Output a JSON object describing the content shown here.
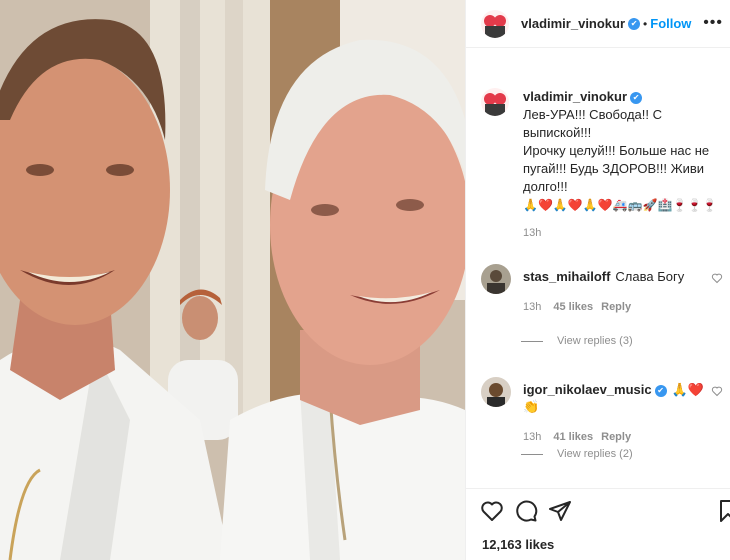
{
  "post": {
    "author": "vladimir_vinokur",
    "verified_mark": "✔",
    "dot": "•",
    "follow_label": "Follow",
    "more_label": "•••",
    "caption_text": "Лев-УРА!!! Свобода!! С выпиской!!!\nИрочку целуй!!! Больше нас не\nпугай!!! Будь ЗДОРОВ!!! Живи\nдолго!!!",
    "caption_emojis": "🙏❤️🙏❤️🙏❤️🚑🚌🚀🏥🍷🍷🍷",
    "time": "13h",
    "likes": "12,163 likes"
  },
  "comments": [
    {
      "user": "stas_mihailoff",
      "text": "Слава Богу",
      "time": "13h",
      "likes": "45 likes",
      "reply": "Reply",
      "view_replies": "View replies (3)"
    },
    {
      "user": "igor_nikolaev_music",
      "text": "🙏❤️👏",
      "time": "13h",
      "likes": "41 likes",
      "reply": "Reply",
      "view_replies": "View replies (2)"
    }
  ],
  "icons": {
    "like": "heart-icon",
    "comment": "comment-icon",
    "share": "share-icon",
    "save": "bookmark-icon",
    "more": "more-icon",
    "verified": "verified-badge-icon"
  },
  "colors": {
    "follow": "#0095f6",
    "verified": "#3897f0",
    "muted": "#8e8e8e"
  }
}
